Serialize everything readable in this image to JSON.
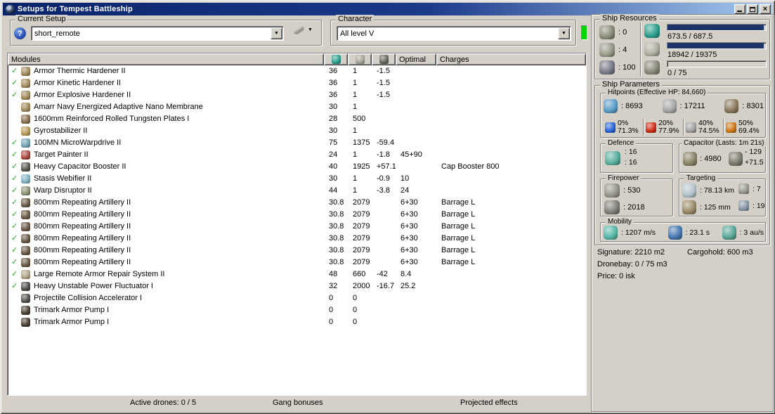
{
  "window": {
    "title": "Setups for Tempest Battleship"
  },
  "glyphs": {
    "check": "✓",
    "combo_arrow": "▼",
    "tools_arrow": "▼",
    "close": "×",
    "help": "?"
  },
  "colors": {
    "titlebar_left": "#0a246a",
    "titlebar_right": "#a6caf0",
    "chrome": "#d4d0c8",
    "bar_fill": "#1c3468",
    "check_green": "#2f9e2f",
    "indicator_green": "#00d800"
  },
  "toolbar": {
    "current_setup": {
      "label": "Current Setup",
      "value": "short_remote"
    },
    "character": {
      "label": "Character",
      "value": "All level V"
    }
  },
  "modules_table": {
    "columns": {
      "modules": "Modules",
      "optimal": "Optimal",
      "charges": "Charges"
    },
    "rows": [
      {
        "active": true,
        "icon": "armor-hardener",
        "name": "Armor Thermic Hardener II",
        "cpu": "36",
        "pg": "1",
        "cap": "-1.5",
        "optimal": "",
        "charges": ""
      },
      {
        "active": true,
        "icon": "armor-hardener",
        "name": "Armor Kinetic Hardener II",
        "cpu": "36",
        "pg": "1",
        "cap": "-1.5",
        "optimal": "",
        "charges": ""
      },
      {
        "active": true,
        "icon": "armor-hardener",
        "name": "Armor Explosive Hardener II",
        "cpu": "36",
        "pg": "1",
        "cap": "-1.5",
        "optimal": "",
        "charges": ""
      },
      {
        "active": false,
        "icon": "armor-membrane",
        "name": "Amarr Navy Energized Adaptive Nano Membrane",
        "cpu": "30",
        "pg": "1",
        "cap": "",
        "optimal": "",
        "charges": ""
      },
      {
        "active": false,
        "icon": "armor-plate",
        "name": "1600mm Reinforced Rolled Tungsten Plates I",
        "cpu": "28",
        "pg": "500",
        "cap": "",
        "optimal": "",
        "charges": ""
      },
      {
        "active": false,
        "icon": "gyrostabilizer",
        "name": "Gyrostabilizer II",
        "cpu": "30",
        "pg": "1",
        "cap": "",
        "optimal": "",
        "charges": ""
      },
      {
        "active": true,
        "icon": "microwarpdrive",
        "name": "100MN MicroWarpdrive II",
        "cpu": "75",
        "pg": "1375",
        "cap": "-59.4",
        "optimal": "",
        "charges": ""
      },
      {
        "active": true,
        "icon": "target-painter",
        "name": "Target Painter II",
        "cpu": "24",
        "pg": "1",
        "cap": "-1.8",
        "optimal": "45+90",
        "charges": ""
      },
      {
        "active": true,
        "icon": "cap-booster",
        "name": "Heavy Capacitor Booster II",
        "cpu": "40",
        "pg": "1925",
        "cap": "+57.1",
        "optimal": "",
        "charges": "Cap Booster 800"
      },
      {
        "active": true,
        "icon": "stasis-webifier",
        "name": "Stasis Webifier II",
        "cpu": "30",
        "pg": "1",
        "cap": "-0.9",
        "optimal": "10",
        "charges": ""
      },
      {
        "active": true,
        "icon": "warp-disruptor",
        "name": "Warp Disruptor II",
        "cpu": "44",
        "pg": "1",
        "cap": "-3.8",
        "optimal": "24",
        "charges": ""
      },
      {
        "active": true,
        "icon": "artillery",
        "name": "800mm Repeating Artillery II",
        "cpu": "30.8",
        "pg": "2079",
        "cap": "",
        "optimal": "6+30",
        "charges": "Barrage L"
      },
      {
        "active": true,
        "icon": "artillery",
        "name": "800mm Repeating Artillery II",
        "cpu": "30.8",
        "pg": "2079",
        "cap": "",
        "optimal": "6+30",
        "charges": "Barrage L"
      },
      {
        "active": true,
        "icon": "artillery",
        "name": "800mm Repeating Artillery II",
        "cpu": "30.8",
        "pg": "2079",
        "cap": "",
        "optimal": "6+30",
        "charges": "Barrage L"
      },
      {
        "active": true,
        "icon": "artillery",
        "name": "800mm Repeating Artillery II",
        "cpu": "30.8",
        "pg": "2079",
        "cap": "",
        "optimal": "6+30",
        "charges": "Barrage L"
      },
      {
        "active": true,
        "icon": "artillery",
        "name": "800mm Repeating Artillery II",
        "cpu": "30.8",
        "pg": "2079",
        "cap": "",
        "optimal": "6+30",
        "charges": "Barrage L"
      },
      {
        "active": true,
        "icon": "artillery",
        "name": "800mm Repeating Artillery II",
        "cpu": "30.8",
        "pg": "2079",
        "cap": "",
        "optimal": "6+30",
        "charges": "Barrage L"
      },
      {
        "active": true,
        "icon": "remote-repair",
        "name": "Large Remote Armor Repair System II",
        "cpu": "48",
        "pg": "660",
        "cap": "-42",
        "optimal": "8.4",
        "charges": ""
      },
      {
        "active": true,
        "icon": "power-fluctuator",
        "name": "Heavy Unstable Power Fluctuator I",
        "cpu": "32",
        "pg": "2000",
        "cap": "-16.7",
        "optimal": "25.2",
        "charges": ""
      },
      {
        "active": false,
        "icon": "rig-projectile",
        "name": "Projectile Collision Accelerator I",
        "cpu": "0",
        "pg": "0",
        "cap": "",
        "optimal": "",
        "charges": ""
      },
      {
        "active": false,
        "icon": "rig-trimark",
        "name": "Trimark Armor Pump I",
        "cpu": "0",
        "pg": "0",
        "cap": "",
        "optimal": "",
        "charges": ""
      },
      {
        "active": false,
        "icon": "rig-trimark",
        "name": "Trimark Armor Pump I",
        "cpu": "0",
        "pg": "0",
        "cap": "",
        "optimal": "",
        "charges": ""
      }
    ]
  },
  "footer": {
    "active_drones": "Active drones: 0 / 5",
    "gang_bonuses": "Gang bonuses",
    "projected_effects": "Projected effects"
  },
  "ship_resources": {
    "title": "Ship Resources",
    "turrets": ": 0",
    "launchers": ": 4",
    "calibration": ": 100",
    "cpu": {
      "text": "673.5 / 687.5",
      "pct": 98
    },
    "powergrid": {
      "text": "18942 / 19375",
      "pct": 97.8
    },
    "dronebay": {
      "text": "0 / 75",
      "pct": 0
    }
  },
  "ship_parameters": {
    "title": "Ship Parameters",
    "hitpoints": {
      "title": "Hitpoints (Effective HP: 84,660)",
      "shield": ": 8693",
      "armor": ": 17211",
      "structure": ": 8301",
      "resists": [
        {
          "kind": "em",
          "shield": "0%",
          "armor": "71.3%"
        },
        {
          "kind": "thermal",
          "shield": "20%",
          "armor": "77.9%"
        },
        {
          "kind": "kinetic",
          "shield": "40%",
          "armor": "74.5%"
        },
        {
          "kind": "explosive",
          "shield": "50%",
          "armor": "69.4%"
        }
      ]
    },
    "defence": {
      "title": "Defence",
      "value1": ": 16",
      "value2": ": 16"
    },
    "capacitor": {
      "title": "Capacitor (Lasts: 1m 21s)",
      "amount": ": 4980",
      "delta_peak": "- 129",
      "delta_recharge": "+71.5"
    },
    "firepower": {
      "title": "Firepower",
      "volley": ": 530",
      "dps": ": 2018"
    },
    "targeting": {
      "title": "Targeting",
      "range": ": 78.13 km",
      "max_targets": ": 7",
      "scan_resolution": ": 125 mm",
      "sensor_strength": ": 19"
    },
    "mobility": {
      "title": "Mobility",
      "speed": ": 1207 m/s",
      "align_time": ": 23.1 s",
      "warp_speed": ": 3 au/s"
    }
  },
  "right_stats": {
    "signature": "Signature: 2210 m2",
    "cargohold": "Cargohold: 600 m3",
    "dronebay": "Dronebay: 0 / 75 m3",
    "price": "Price: 0 isk"
  },
  "icon_colors": {
    "armor-hardener": "#a28a5a",
    "armor-membrane": "#a28a5a",
    "armor-plate": "#8a7050",
    "gyrostabilizer": "#b89858",
    "microwarpdrive": "#74a4b4",
    "target-painter": "#a84840",
    "cap-booster": "#585850",
    "stasis-webifier": "#84b4c4",
    "warp-disruptor": "#8c9478",
    "artillery": "#6a5a46",
    "remote-repair": "#b0a488",
    "power-fluctuator": "#4c4c48",
    "rig-projectile": "#54544e",
    "rig-trimark": "#4a4036",
    "cpu": "#2ea08e",
    "powergrid": "#a8a89a",
    "capacitor": "#6a6a5e",
    "turret": "#8c8c7a",
    "launcher": "#9a9a8a",
    "calibration": "#7a7a88",
    "cpu-gem": "#2ea08e",
    "powergrid-spider": "#b0b0a2",
    "dronebay": "#8a8a7a",
    "shield": "#5a9ec8",
    "armor": "#a8a8a8",
    "structure": "#8a7a5e",
    "em": "#2a66d8",
    "thermal": "#d03018",
    "kinetic": "#a2a2a2",
    "explosive": "#d07818",
    "defence-shield": "#5ab0a0",
    "capacitor-battery": "#8a8468",
    "cap-delta": "#7c7c6c",
    "firepower-turret": "#96968a",
    "dps": "#80807a",
    "range": "#b4c4cc",
    "scan-res": "#9a8a66",
    "max-targets": "#9a9a8e",
    "sensor-strength": "#8898a8",
    "speed": "#58b8a8",
    "align": "#4878b0",
    "warp-speed": "#58a898"
  }
}
